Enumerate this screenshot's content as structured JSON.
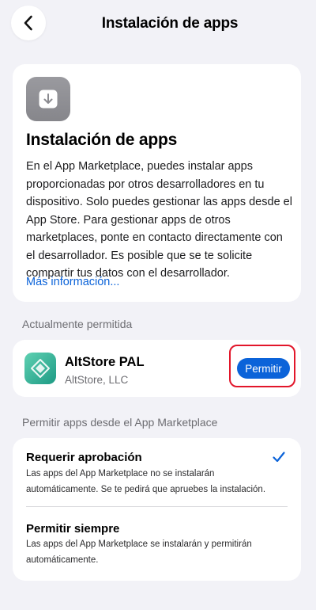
{
  "nav": {
    "title": "Instalación de apps",
    "back_icon": "chevron-left-icon"
  },
  "info": {
    "icon": "download-icon",
    "title": "Instalación de apps",
    "body": "En el App Marketplace, puedes instalar apps proporcionadas por otros desarrolladores en tu dispositivo. Solo puedes gestionar las apps desde el App Store. Para gestionar apps de otros marketplaces, ponte en contacto directamente con el desarrollador. Es posible que se te solicite compartir tus datos con el desarrollador.",
    "link": "Más información..."
  },
  "current": {
    "header": "Actualmente permitida",
    "app_name": "AltStore PAL",
    "developer": "AltStore, LLC",
    "button": "Permitir"
  },
  "marketplace": {
    "header": "Permitir apps desde el App Marketplace",
    "options": [
      {
        "title": "Requerir aprobación",
        "description": "Las apps del App Marketplace no se instalarán automáticamente. Se te pedirá que apruebes la instalación.",
        "selected": true
      },
      {
        "title": "Permitir siempre",
        "description": "Las apps del App Marketplace se instalarán y permitirán automáticamente.",
        "selected": false
      }
    ]
  },
  "colors": {
    "accent": "#0b63d9",
    "highlight": "#e2162a",
    "background": "#f2f2f7"
  }
}
